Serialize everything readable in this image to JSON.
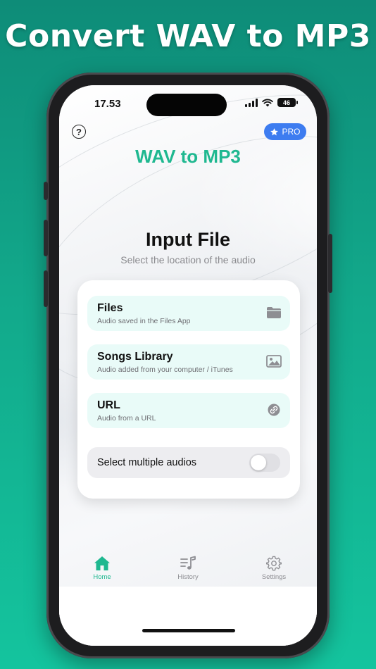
{
  "headline": "Convert WAV to MP3",
  "status": {
    "time": "17.53",
    "battery": "46"
  },
  "header": {
    "help_label": "?",
    "pro_label": "PRO"
  },
  "app_title": "WAV to MP3",
  "section": {
    "title": "Input File",
    "subtitle": "Select the location of the audio"
  },
  "options": [
    {
      "title": "Files",
      "subtitle": "Audio saved in the Files App",
      "icon": "folder-icon"
    },
    {
      "title": "Songs Library",
      "subtitle": "Audio added from your computer / iTunes",
      "icon": "image-icon"
    },
    {
      "title": "URL",
      "subtitle": "Audio from a URL",
      "icon": "link-icon"
    }
  ],
  "multi_select": {
    "label": "Select multiple audios",
    "enabled": false
  },
  "tabs": [
    {
      "label": "Home",
      "icon": "house-icon",
      "active": true
    },
    {
      "label": "History",
      "icon": "music-list-icon",
      "active": false
    },
    {
      "label": "Settings",
      "icon": "gear-icon",
      "active": false
    }
  ],
  "colors": {
    "accent": "#1fb890",
    "pro": "#3d7cf0",
    "option_bg": "#e9fbf8"
  }
}
